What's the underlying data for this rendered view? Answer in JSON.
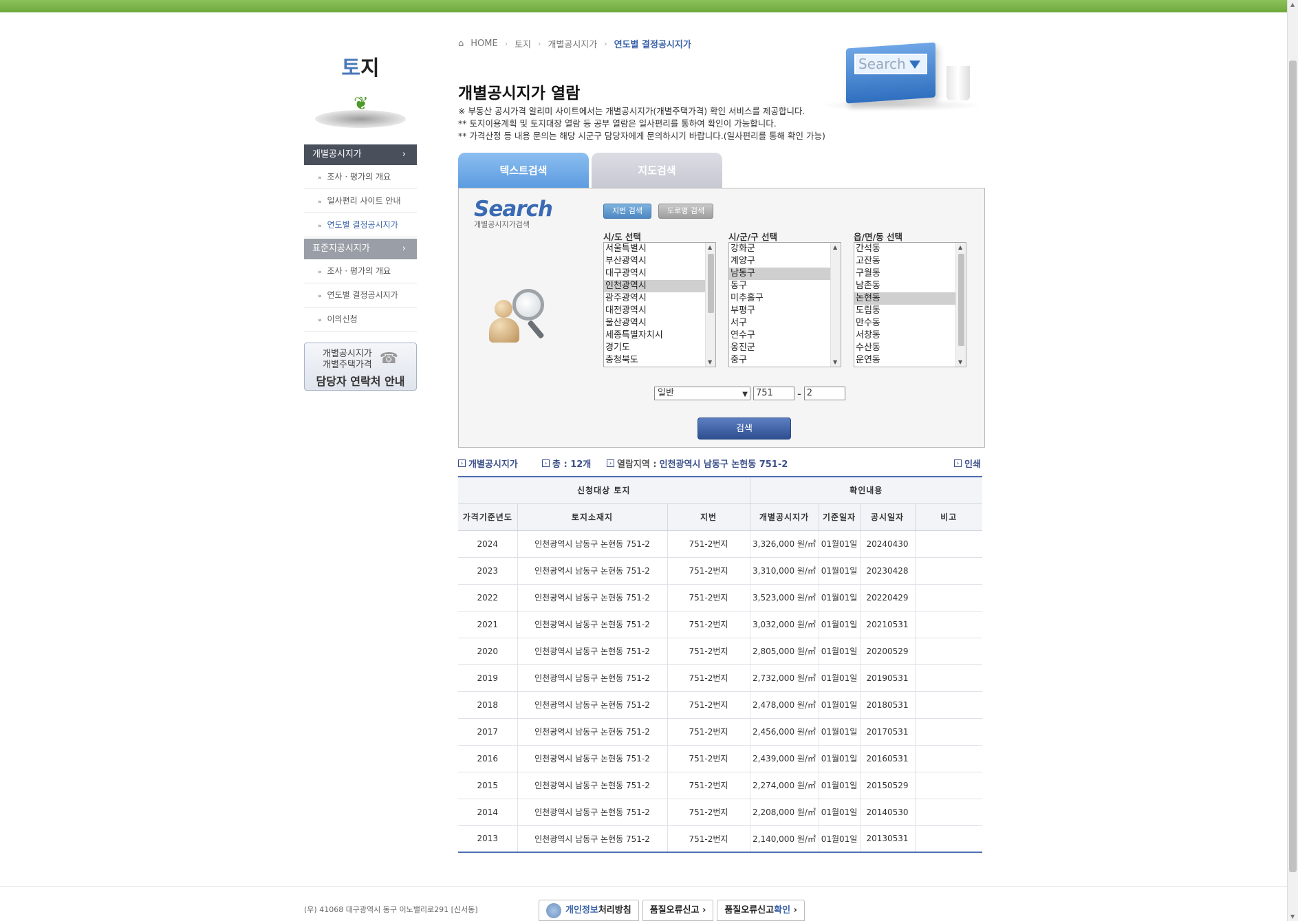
{
  "breadcrumb": {
    "home": "HOME",
    "level1": "토지",
    "level2": "개별공시지가",
    "current": "연도별 결정공시지가"
  },
  "hero": {
    "search_text": "Search"
  },
  "sidebar": {
    "title_accent": "토",
    "title_rest": "지",
    "section1": {
      "label": "개별공시지가",
      "items": [
        "조사 · 평가의 개요",
        "일사편리 사이트 안내",
        "연도별 결정공시지가"
      ]
    },
    "section2": {
      "label": "표준지공시지가",
      "items": [
        "조사 · 평가의 개요",
        "연도별 결정공시지가",
        "이의신청"
      ]
    },
    "contact": {
      "line1": "개별공시지가",
      "line2": "개별주택가격",
      "line3": "담당자 연락처 안내"
    }
  },
  "page": {
    "title": "개별공시지가 열람",
    "notes": [
      "※ 부동산 공시가격 알리미 사이트에서는 개별공시지가(개별주택가격) 확인 서비스를 제공합니다.",
      "** 토지이용계획 및 토지대장 열람 등 공부 열람은 일사편리를 통하여 확인이 가능합니다.",
      "** 가격산정 등 내용 문의는 해당 시군구 담당자에게 문의하시기 바랍니다.(일사편리를 통해 확인 가능)"
    ]
  },
  "tabs": [
    {
      "label": "텍스트검색"
    },
    {
      "label": "지도검색"
    }
  ],
  "search": {
    "logo": "Search",
    "logo_sub": "개별공시지가검색",
    "mode_jibun": "지번 검색",
    "mode_road": "도로명 검색",
    "sido": {
      "label": "시/도 선택",
      "options": [
        "서울특별시",
        "부산광역시",
        "대구광역시",
        "인천광역시",
        "광주광역시",
        "대전광역시",
        "울산광역시",
        "세종특별자치시",
        "경기도",
        "충청북도"
      ],
      "selected": "인천광역시"
    },
    "sigungu": {
      "label": "시/군/구 선택",
      "options": [
        "강화군",
        "계양구",
        "남동구",
        "동구",
        "미추홀구",
        "부평구",
        "서구",
        "연수구",
        "옹진군",
        "중구"
      ],
      "selected": "남동구"
    },
    "dong": {
      "label": "읍/면/동 선택",
      "options": [
        "간석동",
        "고잔동",
        "구월동",
        "남촌동",
        "논현동",
        "도림동",
        "만수동",
        "서창동",
        "수산동",
        "운연동"
      ],
      "selected": "논현동"
    },
    "land_type": "일반",
    "bonbun": "751",
    "bubun": "2",
    "dash": "-",
    "submit": "검색"
  },
  "result": {
    "label1": "개별공시지가",
    "total": "총 : 12개",
    "region_prefix": "열람지역 :",
    "region": "인천광역시 남동구 논현동 751-2",
    "print": "인쇄"
  },
  "table": {
    "group1": "신청대상 토지",
    "group2": "확인내용",
    "headers": [
      "가격기준년도",
      "토지소재지",
      "지번",
      "개별공시지가",
      "기준일자",
      "공시일자",
      "비고"
    ],
    "rows": [
      [
        "2024",
        "인천광역시 남동구 논현동 751-2",
        "751-2번지",
        "3,326,000 원/㎡",
        "01월01일",
        "20240430",
        ""
      ],
      [
        "2023",
        "인천광역시 남동구 논현동 751-2",
        "751-2번지",
        "3,310,000 원/㎡",
        "01월01일",
        "20230428",
        ""
      ],
      [
        "2022",
        "인천광역시 남동구 논현동 751-2",
        "751-2번지",
        "3,523,000 원/㎡",
        "01월01일",
        "20220429",
        ""
      ],
      [
        "2021",
        "인천광역시 남동구 논현동 751-2",
        "751-2번지",
        "3,032,000 원/㎡",
        "01월01일",
        "20210531",
        ""
      ],
      [
        "2020",
        "인천광역시 남동구 논현동 751-2",
        "751-2번지",
        "2,805,000 원/㎡",
        "01월01일",
        "20200529",
        ""
      ],
      [
        "2019",
        "인천광역시 남동구 논현동 751-2",
        "751-2번지",
        "2,732,000 원/㎡",
        "01월01일",
        "20190531",
        ""
      ],
      [
        "2018",
        "인천광역시 남동구 논현동 751-2",
        "751-2번지",
        "2,478,000 원/㎡",
        "01월01일",
        "20180531",
        ""
      ],
      [
        "2017",
        "인천광역시 남동구 논현동 751-2",
        "751-2번지",
        "2,456,000 원/㎡",
        "01월01일",
        "20170531",
        ""
      ],
      [
        "2016",
        "인천광역시 남동구 논현동 751-2",
        "751-2번지",
        "2,439,000 원/㎡",
        "01월01일",
        "20160531",
        ""
      ],
      [
        "2015",
        "인천광역시 남동구 논현동 751-2",
        "751-2번지",
        "2,274,000 원/㎡",
        "01월01일",
        "20150529",
        ""
      ],
      [
        "2014",
        "인천광역시 남동구 논현동 751-2",
        "751-2번지",
        "2,208,000 원/㎡",
        "01월01일",
        "20140530",
        ""
      ],
      [
        "2013",
        "인천광역시 남동구 논현동 751-2",
        "751-2번지",
        "2,140,000 원/㎡",
        "01월01일",
        "20130531",
        ""
      ]
    ]
  },
  "footer": {
    "address": "(우) 41068  대구광역시 동구 이노밸리로291 [신서동]",
    "privacy_em": "개인정보",
    "privacy_rest": "처리방침",
    "report1": "품질오류신고 ›",
    "report2_a": "품질오류신고",
    "report2_em": "확인",
    "report2_b": " ›"
  }
}
